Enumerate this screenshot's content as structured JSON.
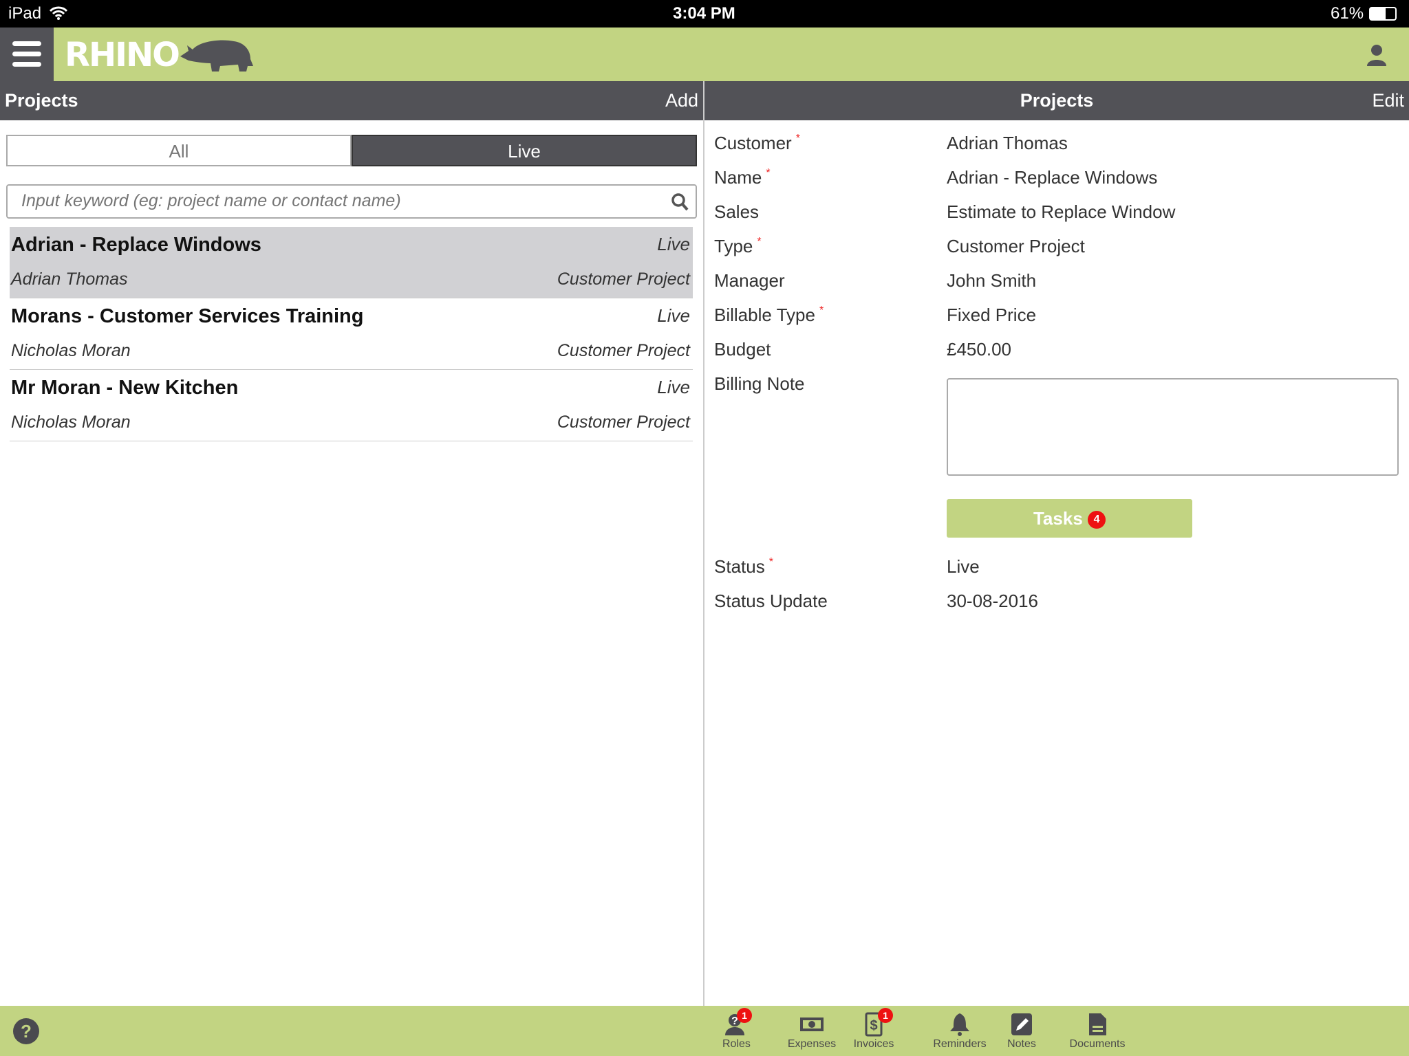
{
  "status_bar": {
    "device": "iPad",
    "time": "3:04 PM",
    "battery": "61%",
    "battery_level": 0.61
  },
  "header": {
    "logo": "RHINO"
  },
  "left": {
    "title": "Projects",
    "add_label": "Add",
    "tabs": [
      {
        "label": "All",
        "active": false
      },
      {
        "label": "Live",
        "active": true
      }
    ],
    "search_placeholder": "Input keyword (eg: project name or contact name)",
    "projects": [
      {
        "title": "Adrian - Replace Windows",
        "status": "Live",
        "contact": "Adrian Thomas",
        "type": "Customer Project",
        "selected": true
      },
      {
        "title": "Morans - Customer Services Training",
        "status": "Live",
        "contact": "Nicholas Moran",
        "type": "Customer Project"
      },
      {
        "title": "Mr Moran - New Kitchen",
        "status": "Live",
        "contact": "Nicholas Moran",
        "type": "Customer Project"
      }
    ]
  },
  "right": {
    "title": "Projects",
    "edit_label": "Edit",
    "fields": [
      {
        "label": "Customer",
        "required": true,
        "value": "Adrian Thomas"
      },
      {
        "label": "Name",
        "required": true,
        "value": "Adrian - Replace Windows"
      },
      {
        "label": "Sales",
        "required": false,
        "value": "Estimate to Replace Window"
      },
      {
        "label": "Type",
        "required": true,
        "value": "Customer Project"
      },
      {
        "label": "Manager",
        "required": false,
        "value": "John Smith"
      },
      {
        "label": "Billable Type",
        "required": true,
        "value": "Fixed Price"
      },
      {
        "label": "Budget",
        "required": false,
        "value": "£450.00"
      }
    ],
    "billing_note_label": "Billing Note",
    "billing_note_value": "",
    "tasks_label": "Tasks",
    "tasks_count": "4",
    "status_label": "Status",
    "status_value": "Live",
    "status_update_label": "Status Update",
    "status_update_value": "30-08-2016"
  },
  "bottom": {
    "items": [
      {
        "label": "Roles",
        "icon": "user-question-icon",
        "badge": "1"
      },
      {
        "label": "Expenses",
        "icon": "banknote-icon"
      },
      {
        "label": "Invoices",
        "icon": "invoice-dollar-icon",
        "badge": "1"
      },
      {
        "label": "Reminders",
        "icon": "bell-icon"
      },
      {
        "label": "Notes",
        "icon": "pencil-square-icon"
      },
      {
        "label": "Documents",
        "icon": "document-icon"
      }
    ]
  },
  "colors": {
    "accent": "#c2d482",
    "dark": "#525257",
    "badge": "#ee1111"
  }
}
